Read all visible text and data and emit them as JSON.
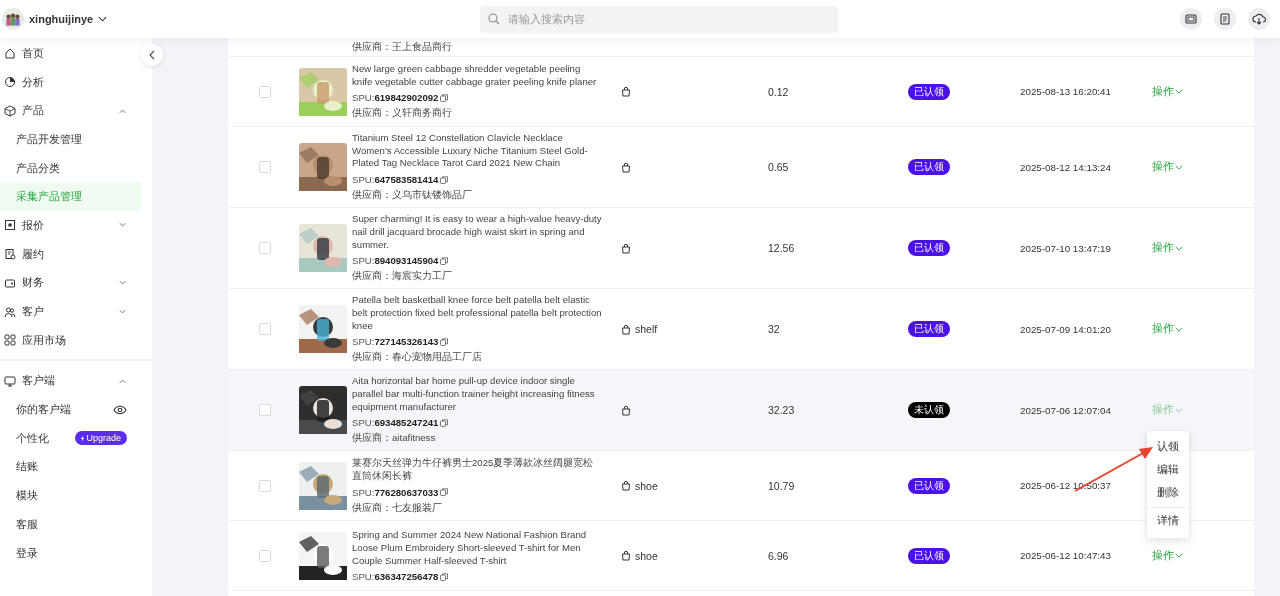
{
  "header": {
    "account": "xinghuijinye",
    "search": {
      "placeholder": "请输入搜索内容"
    }
  },
  "sidebar": {
    "sections": [
      {
        "items": [
          {
            "label": "首页",
            "selected": false
          },
          {
            "label": "分析",
            "selected": false
          },
          {
            "label": "产品",
            "selected": false,
            "expanded": true,
            "children": [
              {
                "label": "产品开发管理",
                "selected": false
              },
              {
                "label": "产品分类",
                "selected": false
              },
              {
                "label": "采集产品管理",
                "selected": true
              }
            ]
          },
          {
            "label": "报价",
            "selected": false,
            "expanded": false
          },
          {
            "label": "履约",
            "selected": false
          },
          {
            "label": "财务",
            "selected": false,
            "expanded": false
          },
          {
            "label": "客户",
            "selected": false,
            "expanded": false
          },
          {
            "label": "应用市场",
            "selected": false
          }
        ]
      },
      {
        "items": [
          {
            "label": "客户端",
            "selected": false,
            "expanded": true,
            "children": [
              {
                "label": "你的客户端",
                "selected": false,
                "kind": "preview"
              },
              {
                "label": "个性化",
                "selected": false,
                "kind": "upgrade",
                "badge": "Upgrade"
              },
              {
                "label": "结账",
                "selected": false,
                "kind": "plain"
              },
              {
                "label": "模块",
                "selected": false,
                "kind": "plain"
              },
              {
                "label": "客服",
                "selected": false,
                "kind": "plain"
              },
              {
                "label": "登录",
                "selected": false,
                "kind": "plain"
              }
            ]
          }
        ]
      }
    ]
  },
  "table": {
    "partial_row": {
      "supplier": "供应商：王上食品商行"
    },
    "rows": [
      {
        "checked": false,
        "hovered": false,
        "title": "New large green cabbage shredder vegetable peeling knife vegetable cutter cabbage grater peeling knife planer",
        "spu_label": "SPU:",
        "spu": "619842902092",
        "supplier": "供应商：义轩商务商行",
        "price": "0.12",
        "status": "已认领",
        "claimed": true,
        "date": "2025-08-13 16:20:41",
        "action": "操作"
      },
      {
        "checked": false,
        "hovered": false,
        "title": "Titanium Steel 12 Constellation Clavicle Necklace Women's Accessible Luxury Niche Titanium Steel Gold-Plated Tag Necklace Tarot Card 2021 New Chain",
        "spu_label": "SPU:",
        "spu": "647583581414",
        "supplier": "供应商：义乌市钛镂饰品厂",
        "price": "0.65",
        "status": "已认领",
        "claimed": true,
        "date": "2025-08-12 14:13:24",
        "action": "操作"
      },
      {
        "checked": false,
        "hovered": false,
        "title": "Super charming! It is easy to wear a high-value heavy-duty nail drill jacquard brocade high waist skirt in spring and summer.",
        "spu_label": "SPU:",
        "spu": "894093145904",
        "supplier": "供应商：海宸实力工厂",
        "price": "12.56",
        "status": "已认领",
        "claimed": true,
        "date": "2025-07-10 13:47:19",
        "action": "操作"
      },
      {
        "checked": false,
        "hovered": false,
        "title": "Patella belt basketball knee force belt patella belt elastic belt protection fixed belt professional patella belt protection knee",
        "spu_label": "SPU:",
        "spu": "727145326143",
        "supplier": "供应商：春心宠物用品工厂店",
        "shelf": "shelf",
        "price": "32",
        "status": "已认领",
        "claimed": true,
        "date": "2025-07-09 14:01:20",
        "action": "操作"
      },
      {
        "checked": false,
        "hovered": true,
        "title": "Aita horizontal bar home pull-up device indoor single parallel bar multi-function trainer height increasing fitness equipment manufacturer",
        "spu_label": "SPU:",
        "spu": "693485247241",
        "supplier": "供应商：aitafitness",
        "price": "32.23",
        "status": "未认领",
        "claimed": false,
        "date": "2025-07-06 12:07:04",
        "action": "操作"
      },
      {
        "checked": false,
        "hovered": false,
        "title": "莱赛尔天丝弹力牛仔裤男士2025夏季薄款冰丝阔腿宽松直筒休闲长裤",
        "spu_label": "SPU:",
        "spu": "776280637033",
        "supplier": "供应商：七友服装厂",
        "shelf": "shoe",
        "price": "10.79",
        "status": "已认领",
        "claimed": true,
        "date": "2025-06-12 10:50:37"
      },
      {
        "checked": false,
        "hovered": false,
        "title": "Spring and Summer 2024 New National Fashion Brand Loose Plum Embroidery Short-sleeved T-shirt for Men Couple Summer Half-sleeved T-shirt",
        "spu_label": "SPU:",
        "spu": "636347256478",
        "shelf": "shoe",
        "price": "6.96",
        "status": "已认领",
        "claimed": true,
        "date": "2025-06-12 10:47:43",
        "action": "操作"
      }
    ]
  },
  "action_menu": {
    "items": [
      {
        "label": "认领",
        "separated": false
      },
      {
        "label": "编辑",
        "separated": false
      },
      {
        "label": "删除",
        "separated": false
      },
      {
        "label": "详情",
        "separated": true
      }
    ]
  }
}
